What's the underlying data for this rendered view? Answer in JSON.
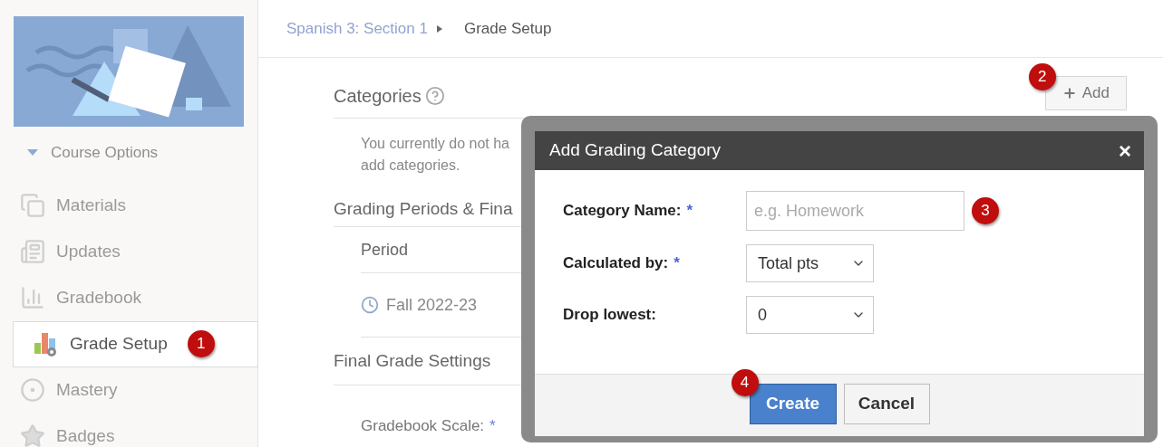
{
  "sidebar": {
    "menu_toggle": "Course Options",
    "items": [
      {
        "label": "Materials",
        "kind": "materials",
        "selected": false
      },
      {
        "label": "Updates",
        "kind": "updates",
        "selected": false
      },
      {
        "label": "Gradebook",
        "kind": "gradebook",
        "selected": false
      },
      {
        "label": "Grade Setup",
        "kind": "grade-setup",
        "selected": true,
        "callout": "1"
      },
      {
        "label": "Mastery",
        "kind": "mastery",
        "selected": false
      },
      {
        "label": "Badges",
        "kind": "badges",
        "selected": false
      }
    ]
  },
  "breadcrumb": {
    "parent": "Spanish 3: Section 1",
    "current": "Grade Setup"
  },
  "categories": {
    "heading": "Categories",
    "add_button": "Add",
    "add_callout": "2",
    "empty_text": [
      "You currently do not ha",
      "add categories."
    ]
  },
  "grading_periods": {
    "heading": "Grading Periods & Fina",
    "column": "Period",
    "rows": [
      "Fall 2022-23"
    ]
  },
  "final_grade": {
    "heading": "Final Grade Settings",
    "scale_label": "Gradebook Scale:",
    "required": "*"
  },
  "dialog": {
    "title": "Add Grading Category",
    "close": "×",
    "fields": [
      {
        "kind": "text",
        "label": "Category Name:",
        "required": true,
        "placeholder": "e.g. Homework",
        "callout": "3"
      },
      {
        "kind": "select",
        "label": "Calculated by:",
        "required": true,
        "value": "Total pts"
      },
      {
        "kind": "select",
        "label": "Drop lowest:",
        "required": false,
        "value": "0"
      }
    ],
    "buttons": [
      {
        "label": "Create",
        "primary": true,
        "callout": "4"
      },
      {
        "label": "Cancel",
        "primary": false
      }
    ]
  }
}
